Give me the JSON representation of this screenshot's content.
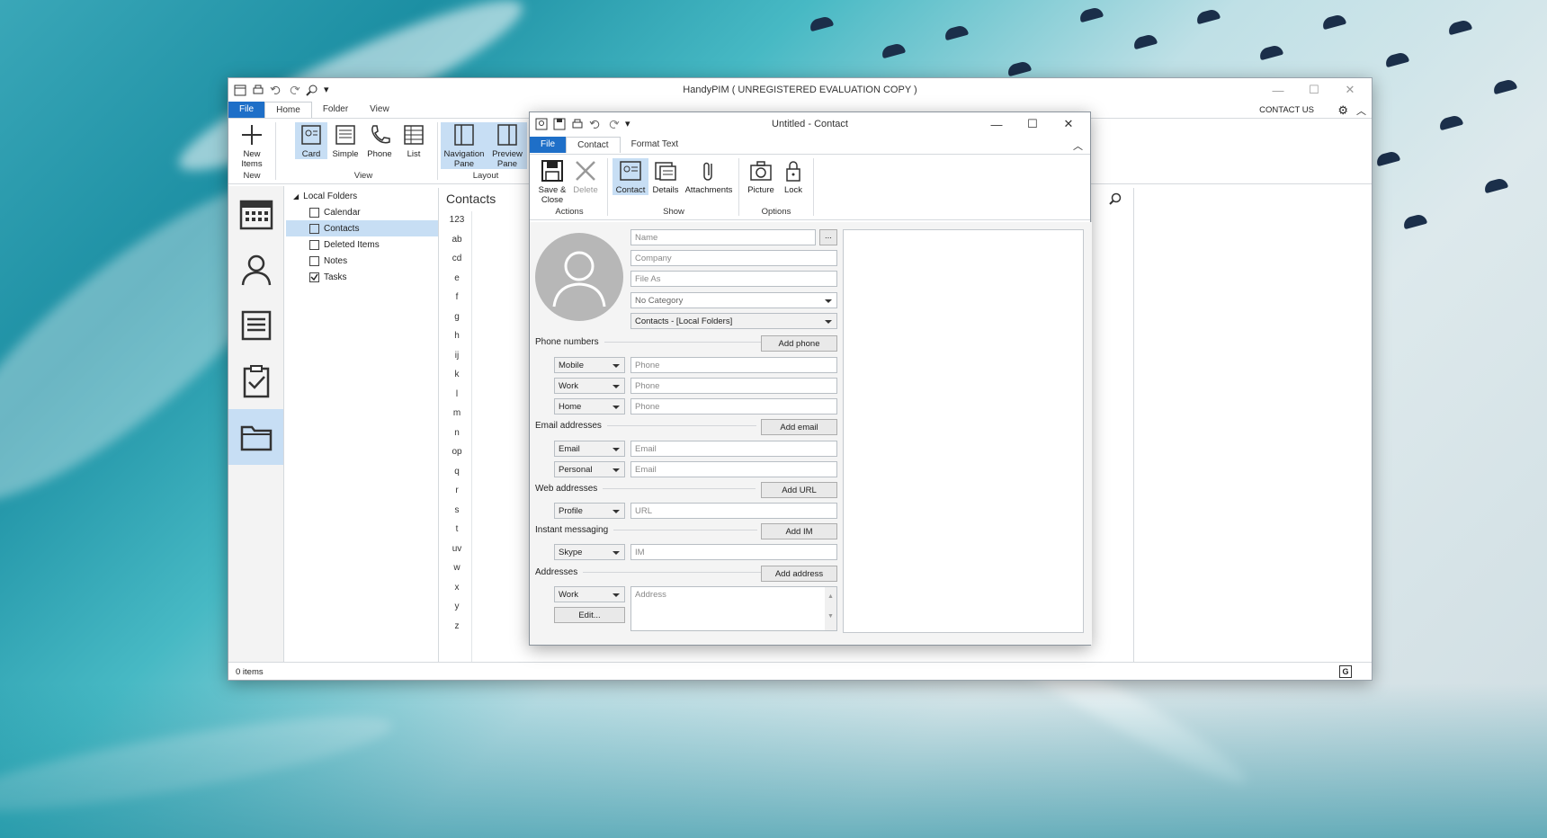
{
  "main_window": {
    "title": "HandyPIM ( UNREGISTERED EVALUATION COPY )",
    "contact_us": "CONTACT US",
    "tabs": [
      {
        "label": "File"
      },
      {
        "label": "Home"
      },
      {
        "label": "Folder"
      },
      {
        "label": "View"
      }
    ],
    "ribbon": {
      "new_items": "New Items",
      "group_new": "New",
      "card": "Card",
      "simple": "Simple",
      "phone": "Phone",
      "list": "List",
      "group_view": "View",
      "navigation_pane": "Navigation Pane",
      "preview_pane": "Preview Pane",
      "group_layout": "Layout"
    },
    "folders": {
      "root": "Local Folders",
      "items": [
        {
          "label": "Calendar",
          "icon": "calendar-icon"
        },
        {
          "label": "Contacts",
          "icon": "contacts-icon"
        },
        {
          "label": "Deleted Items",
          "icon": "trash-icon"
        },
        {
          "label": "Notes",
          "icon": "notes-icon"
        },
        {
          "label": "Tasks",
          "icon": "tasks-icon"
        }
      ]
    },
    "contacts_title": "Contacts",
    "alphabet": [
      "123",
      "ab",
      "cd",
      "e",
      "f",
      "g",
      "h",
      "ij",
      "k",
      "l",
      "m",
      "n",
      "op",
      "q",
      "r",
      "s",
      "t",
      "uv",
      "w",
      "x",
      "y",
      "z"
    ],
    "status": "0 items"
  },
  "contact_window": {
    "title": "Untitled - Contact",
    "tabs": [
      {
        "label": "File"
      },
      {
        "label": "Contact"
      },
      {
        "label": "Format Text"
      }
    ],
    "ribbon": {
      "save_close": "Save & Close",
      "delete": "Delete",
      "group_actions": "Actions",
      "contact": "Contact",
      "details": "Details",
      "attachments": "Attachments",
      "group_show": "Show",
      "picture": "Picture",
      "lock": "Lock",
      "group_options": "Options"
    },
    "form": {
      "name_placeholder": "Name",
      "ellipsis": "...",
      "company_placeholder": "Company",
      "file_as_placeholder": "File As",
      "category": "No Category",
      "folder": "Contacts - [Local Folders]",
      "phone_section": "Phone numbers",
      "add_phone": "Add phone",
      "phones": [
        {
          "type": "Mobile",
          "placeholder": "Phone"
        },
        {
          "type": "Work",
          "placeholder": "Phone"
        },
        {
          "type": "Home",
          "placeholder": "Phone"
        }
      ],
      "email_section": "Email addresses",
      "add_email": "Add email",
      "emails": [
        {
          "type": "Email",
          "placeholder": "Email"
        },
        {
          "type": "Personal",
          "placeholder": "Email"
        }
      ],
      "web_section": "Web addresses",
      "add_url": "Add URL",
      "web": {
        "type": "Profile",
        "placeholder": "URL"
      },
      "im_section": "Instant messaging",
      "add_im": "Add IM",
      "im": {
        "type": "Skype",
        "placeholder": "IM"
      },
      "address_section": "Addresses",
      "add_address": "Add address",
      "address": {
        "type": "Work",
        "placeholder": "Address"
      },
      "edit": "Edit..."
    }
  }
}
